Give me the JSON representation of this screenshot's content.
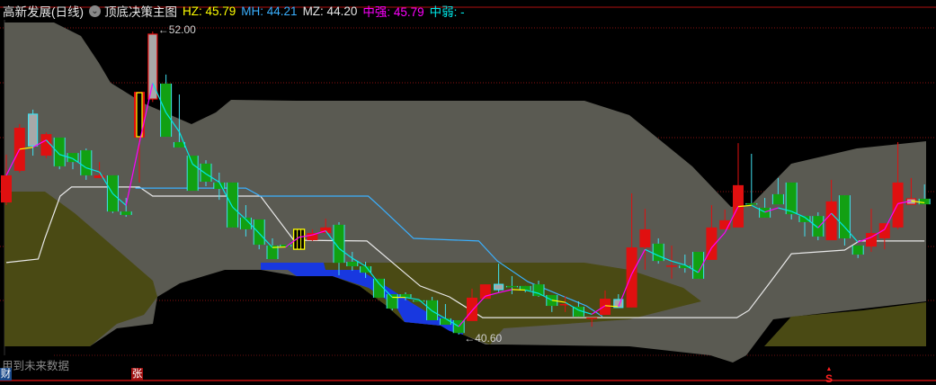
{
  "header": {
    "stock_name": "高新发展(日线)",
    "indicator_name": "顶底决策主图",
    "hz": "HZ: 45.79",
    "mh": "MH: 44.21",
    "mz": "MZ: 44.20",
    "zhongqiang": "中强: 45.79",
    "zhongruo": "中弱: -",
    "dropdown_icon": "chevron-down-circle-icon"
  },
  "footer": {
    "note": "用到未来数据",
    "badge_cai": "财",
    "badge_zhang": "张",
    "marker_s": "S"
  },
  "colors": {
    "up": "#e01010",
    "down_fill": "#12a012",
    "down_edge": "#40e0f0",
    "special_gray": "#a8a8a8",
    "hz": "#ffff00",
    "mh": "#3ab0ff",
    "mz": "#e8e8e8",
    "zhongqiang": "#ff00ff",
    "zhongruo": "#00e8e8",
    "grid": "#8a1010"
  },
  "chart_data": {
    "type": "candlestick",
    "title": "高新发展(日线) 顶底决策主图",
    "price_range": [
      40.3,
      52.4
    ],
    "annotations": [
      {
        "label": "52.00",
        "candle": 11,
        "price": 52.0
      },
      {
        "label": "40.60",
        "candle": 34,
        "price": 40.6
      }
    ],
    "candles": [
      {
        "o": 45.57,
        "h": 47.37,
        "l": 45.47,
        "c": 46.59
      },
      {
        "o": 46.76,
        "h": 48.52,
        "l": 46.69,
        "c": 48.38
      },
      {
        "o": 48.89,
        "h": 49.06,
        "l": 47.33,
        "c": 47.7,
        "style": "gray"
      },
      {
        "o": 47.33,
        "h": 48.21,
        "l": 47.23,
        "c": 48.14
      },
      {
        "o": 48.01,
        "h": 48.01,
        "l": 46.82,
        "c": 46.93
      },
      {
        "o": 47.43,
        "h": 47.43,
        "l": 46.82,
        "c": 47.09
      },
      {
        "o": 47.53,
        "h": 47.6,
        "l": 46.42,
        "c": 46.59
      },
      {
        "o": 46.49,
        "h": 47.09,
        "l": 46.49,
        "c": 46.59
      },
      {
        "o": 46.59,
        "h": 46.59,
        "l": 45.17,
        "c": 45.23
      },
      {
        "o": 45.23,
        "h": 45.74,
        "l": 45.03,
        "c": 45.1
      },
      {
        "o": 48.01,
        "h": 49.73,
        "l": 46.32,
        "c": 49.73,
        "style": "yellow"
      },
      {
        "o": 49.46,
        "h": 52.0,
        "l": 49.35,
        "c": 51.9,
        "style": "gray"
      },
      {
        "o": 50.04,
        "h": 50.38,
        "l": 48.04,
        "c": 48.04
      },
      {
        "o": 47.84,
        "h": 49.63,
        "l": 47.64,
        "c": 47.64
      },
      {
        "o": 47.33,
        "h": 47.33,
        "l": 46.01,
        "c": 46.01
      },
      {
        "o": 47.03,
        "h": 47.16,
        "l": 46.18,
        "c": 46.35
      },
      {
        "o": 46.32,
        "h": 46.69,
        "l": 45.67,
        "c": 46.08
      },
      {
        "o": 46.32,
        "h": 46.32,
        "l": 44.63,
        "c": 44.63
      },
      {
        "o": 45.0,
        "h": 45.47,
        "l": 44.29,
        "c": 44.56
      },
      {
        "o": 44.93,
        "h": 44.93,
        "l": 43.81,
        "c": 43.98
      },
      {
        "o": 43.95,
        "h": 44.22,
        "l": 43.44,
        "c": 43.44
      },
      {
        "o": 43.98,
        "h": 43.98,
        "l": 43.91,
        "c": 43.91
      },
      {
        "o": 43.81,
        "h": 44.56,
        "l": 43.81,
        "c": 44.56,
        "style": "striped"
      },
      {
        "o": 44.15,
        "h": 44.56,
        "l": 44.12,
        "c": 44.42
      },
      {
        "o": 44.42,
        "h": 44.96,
        "l": 44.42,
        "c": 44.63
      },
      {
        "o": 44.73,
        "h": 44.83,
        "l": 42.83,
        "c": 43.3
      },
      {
        "o": 43.34,
        "h": 43.71,
        "l": 43.0,
        "c": 43.17
      },
      {
        "o": 43.17,
        "h": 43.34,
        "l": 42.73,
        "c": 42.93
      },
      {
        "o": 42.7,
        "h": 42.7,
        "l": 41.99,
        "c": 41.99
      },
      {
        "o": 42.12,
        "h": 42.12,
        "l": 41.51,
        "c": 41.58
      },
      {
        "o": 42.12,
        "h": 42.19,
        "l": 41.89,
        "c": 41.99
      },
      {
        "o": 41.89,
        "h": 41.89,
        "l": 41.85,
        "c": 41.85
      },
      {
        "o": 41.89,
        "h": 42.02,
        "l": 41.14,
        "c": 41.14
      },
      {
        "o": 41.21,
        "h": 41.75,
        "l": 40.97,
        "c": 40.97
      },
      {
        "o": 41.14,
        "h": 41.14,
        "l": 40.6,
        "c": 40.66
      },
      {
        "o": 41.11,
        "h": 42.33,
        "l": 41.11,
        "c": 41.99
      },
      {
        "o": 41.95,
        "h": 42.49,
        "l": 41.95,
        "c": 42.49
      },
      {
        "o": 42.49,
        "h": 43.27,
        "l": 42.19,
        "c": 42.29,
        "style": "gray"
      },
      {
        "o": 42.43,
        "h": 42.8,
        "l": 42.12,
        "c": 42.39
      },
      {
        "o": 42.43,
        "h": 42.43,
        "l": 42.19,
        "c": 42.26
      },
      {
        "o": 42.49,
        "h": 42.63,
        "l": 42.02,
        "c": 42.05
      },
      {
        "o": 42.09,
        "h": 42.09,
        "l": 41.45,
        "c": 41.68
      },
      {
        "o": 41.71,
        "h": 42.05,
        "l": 41.45,
        "c": 41.75
      },
      {
        "o": 41.65,
        "h": 41.85,
        "l": 41.28,
        "c": 41.28
      },
      {
        "o": 41.24,
        "h": 41.24,
        "l": 40.9,
        "c": 41.24
      },
      {
        "o": 41.34,
        "h": 42.26,
        "l": 41.34,
        "c": 41.95
      },
      {
        "o": 41.92,
        "h": 42.12,
        "l": 41.62,
        "c": 41.62,
        "style": "gray"
      },
      {
        "o": 41.62,
        "h": 45.91,
        "l": 41.62,
        "c": 43.88
      },
      {
        "o": 43.88,
        "h": 45.33,
        "l": 43.04,
        "c": 44.56
      },
      {
        "o": 44.02,
        "h": 44.22,
        "l": 43.27,
        "c": 43.37
      },
      {
        "o": 43.2,
        "h": 43.95,
        "l": 42.7,
        "c": 43.2
      },
      {
        "o": 43.2,
        "h": 43.61,
        "l": 42.93,
        "c": 43.1
      },
      {
        "o": 43.71,
        "h": 43.71,
        "l": 42.7,
        "c": 42.7
      },
      {
        "o": 43.41,
        "h": 45.47,
        "l": 43.41,
        "c": 44.63
      },
      {
        "o": 44.56,
        "h": 45.3,
        "l": 44.56,
        "c": 44.9
      },
      {
        "o": 44.63,
        "h": 47.8,
        "l": 44.63,
        "c": 46.22
      },
      {
        "o": 45.54,
        "h": 47.4,
        "l": 45.5,
        "c": 45.5
      },
      {
        "o": 45.37,
        "h": 45.74,
        "l": 45.0,
        "c": 45.0
      },
      {
        "o": 45.88,
        "h": 46.49,
        "l": 45.5,
        "c": 45.5
      },
      {
        "o": 46.32,
        "h": 46.32,
        "l": 44.93,
        "c": 45.13
      },
      {
        "o": 45.06,
        "h": 45.06,
        "l": 44.29,
        "c": 44.83
      },
      {
        "o": 45.06,
        "h": 45.2,
        "l": 44.15,
        "c": 44.29
      },
      {
        "o": 44.15,
        "h": 46.42,
        "l": 44.15,
        "c": 45.61
      },
      {
        "o": 45.84,
        "h": 45.84,
        "l": 43.95,
        "c": 44.22
      },
      {
        "o": 43.95,
        "h": 43.95,
        "l": 43.48,
        "c": 43.61
      },
      {
        "o": 43.91,
        "h": 45.33,
        "l": 43.71,
        "c": 44.42
      },
      {
        "o": 44.22,
        "h": 44.79,
        "l": 43.81,
        "c": 44.79
      },
      {
        "o": 44.63,
        "h": 47.84,
        "l": 44.56,
        "c": 46.32
      },
      {
        "o": 45.5,
        "h": 46.49,
        "l": 45.5,
        "c": 45.71,
        "style": "gray"
      },
      {
        "o": 45.71,
        "h": 46.25,
        "l": 45.5,
        "c": 45.5
      }
    ],
    "lines": [
      {
        "name": "white-line",
        "color": "#e8e8e8",
        "points": [
          [
            0,
            43.31
          ],
          [
            2.4,
            43.44
          ],
          [
            2.9,
            44.22
          ],
          [
            4.05,
            45.81
          ],
          [
            4.9,
            46.15
          ],
          [
            10,
            46.15
          ],
          [
            11,
            45.81
          ],
          [
            19.1,
            45.81
          ],
          [
            21.6,
            44.15
          ],
          [
            27.1,
            44.12
          ],
          [
            31.1,
            42.43
          ],
          [
            33.3,
            42.02
          ],
          [
            35.8,
            41.24
          ],
          [
            54.9,
            41.24
          ],
          [
            55.8,
            41.51
          ],
          [
            57.6,
            42.7
          ],
          [
            59,
            43.64
          ],
          [
            63,
            43.78
          ],
          [
            64.1,
            44.12
          ],
          [
            69,
            44.12
          ]
        ]
      },
      {
        "name": "blue-line",
        "color": "#3ab0ff",
        "points": [
          [
            9.7,
            46.11
          ],
          [
            18,
            46.11
          ],
          [
            19.1,
            45.81
          ],
          [
            27.2,
            45.81
          ],
          [
            28.1,
            45.4
          ],
          [
            30.6,
            44.22
          ],
          [
            35.5,
            44.12
          ],
          [
            36.9,
            43.37
          ],
          [
            39.2,
            42.59
          ],
          [
            43.6,
            41.68
          ],
          [
            44.8,
            41.28
          ]
        ]
      }
    ]
  }
}
